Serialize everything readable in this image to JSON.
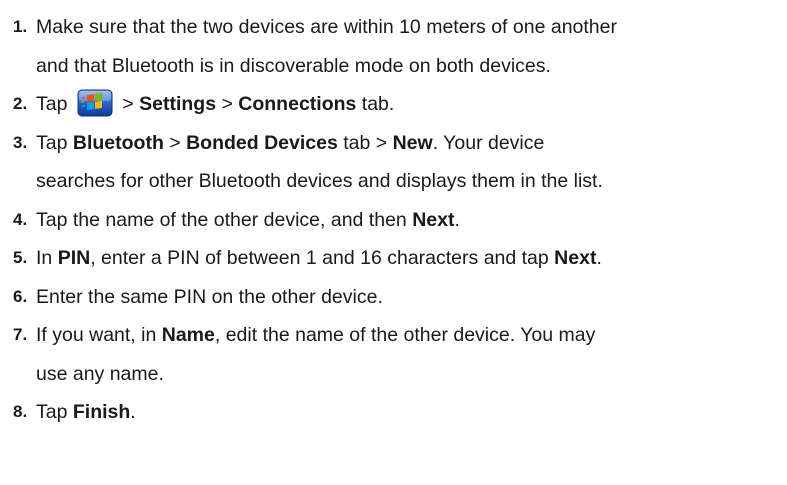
{
  "steps": [
    {
      "number": "1.",
      "lines": [
        "Make sure that the two devices are within 10 meters of one another",
        "and that Bluetooth is in discoverable mode on both devices."
      ]
    },
    {
      "number": "2.",
      "segments": {
        "t1": "Tap",
        "icon": "windows-start-icon",
        "sep1": ">",
        "b1": "Settings",
        "sep2": ">",
        "b2": "Connections",
        "t2": "tab."
      }
    },
    {
      "number": "3.",
      "line1": {
        "t1": "Tap",
        "b1": "Bluetooth",
        "sep1": ">",
        "b2": "Bonded Devices",
        "t2": "tab >",
        "b3": "New",
        "t3": ". Your device"
      },
      "line2": "searches for other Bluetooth devices and displays them in the list."
    },
    {
      "number": "4.",
      "segments": {
        "t1": "Tap the name of the other device, and then",
        "b1": "Next",
        "t2": "."
      }
    },
    {
      "number": "5.",
      "segments": {
        "t1": "In",
        "b1": "PIN",
        "t2": ", enter a PIN of between 1 and 16 characters and tap",
        "b2": "Next",
        "t3": "."
      }
    },
    {
      "number": "6.",
      "text": "Enter the same PIN on the other device."
    },
    {
      "number": "7.",
      "line1": {
        "t1": "If you want, in",
        "b1": "Name",
        "t2": ", edit the name of the other device. You may"
      },
      "line2": "use any name."
    },
    {
      "number": "8.",
      "segments": {
        "t1": "Tap",
        "b1": "Finish",
        "t2": "."
      }
    }
  ]
}
